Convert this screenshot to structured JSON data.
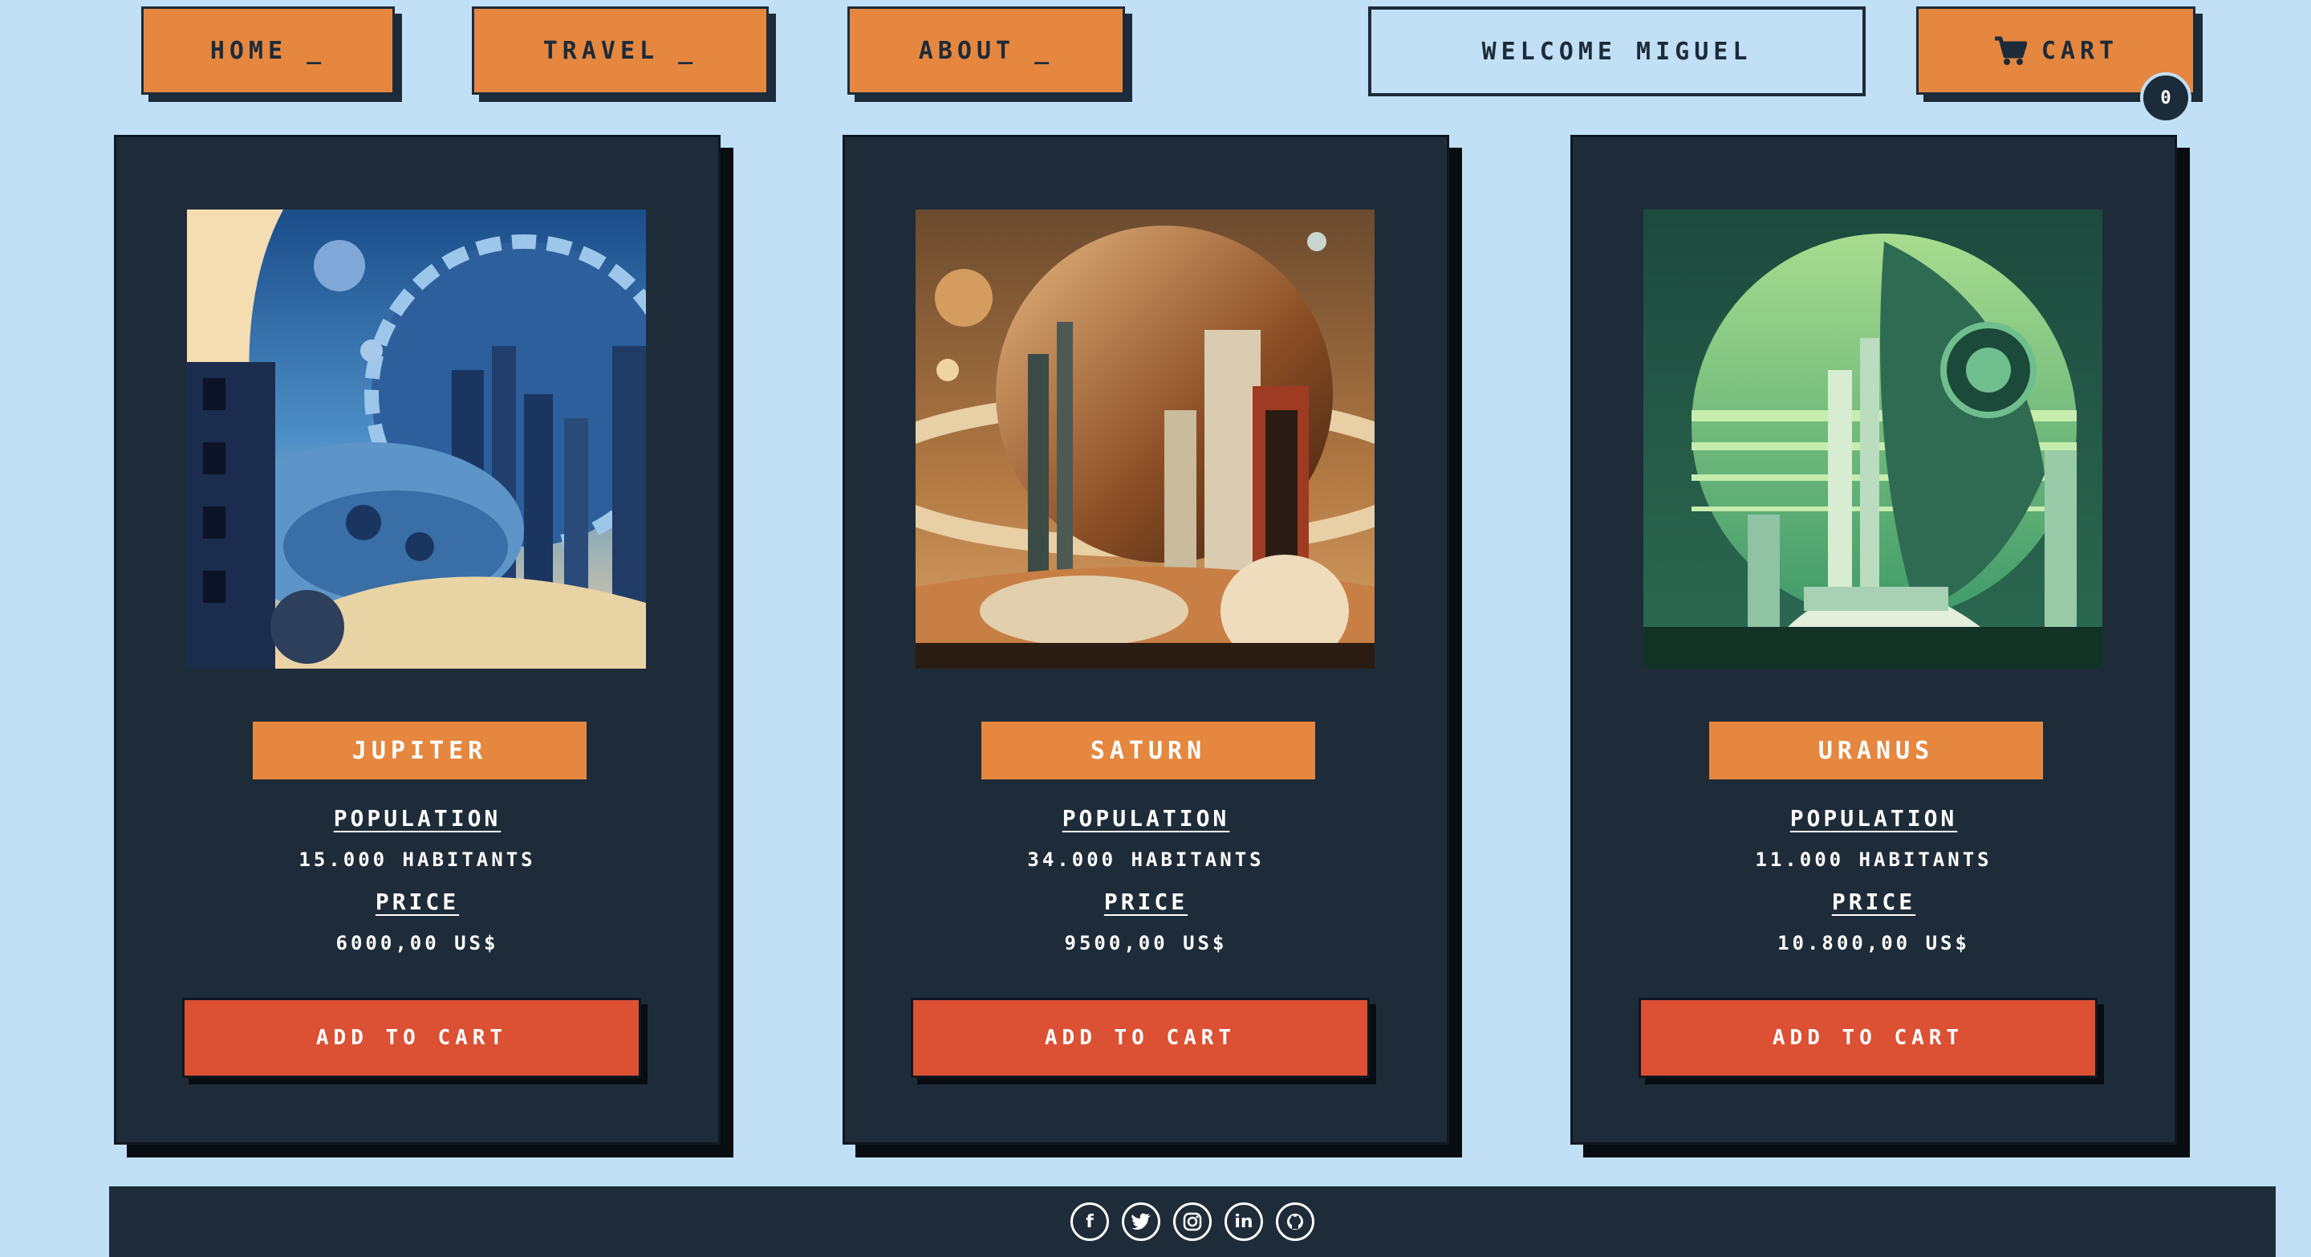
{
  "nav": {
    "home": "Home",
    "travel": "Travel",
    "about": "About",
    "welcome": "Welcome Miguel",
    "cart": "Cart",
    "cart_badge": "0"
  },
  "cards": [
    {
      "name": "Jupiter",
      "population_label": "Population",
      "population": "15.000 habitants",
      "price_label": "Price",
      "price": "6000,00 US$",
      "button": "Add to cart"
    },
    {
      "name": "Saturn",
      "population_label": "Population",
      "population": "34.000 habitants",
      "price_label": "Price",
      "price": "9500,00 US$",
      "button": "Add to cart"
    },
    {
      "name": "Uranus",
      "population_label": "Population",
      "population": "11.000 habitants",
      "price_label": "Price",
      "price": "10.800,00 US$",
      "button": "Add to cart"
    }
  ],
  "footer": {
    "icons": [
      "facebook-icon",
      "twitter-icon",
      "instagram-icon",
      "linkedin-icon",
      "github-icon"
    ]
  },
  "colors": {
    "background": "#c2e0f5",
    "accent": "#e5873f",
    "button": "#dc5034",
    "card": "#1e2c3a"
  }
}
